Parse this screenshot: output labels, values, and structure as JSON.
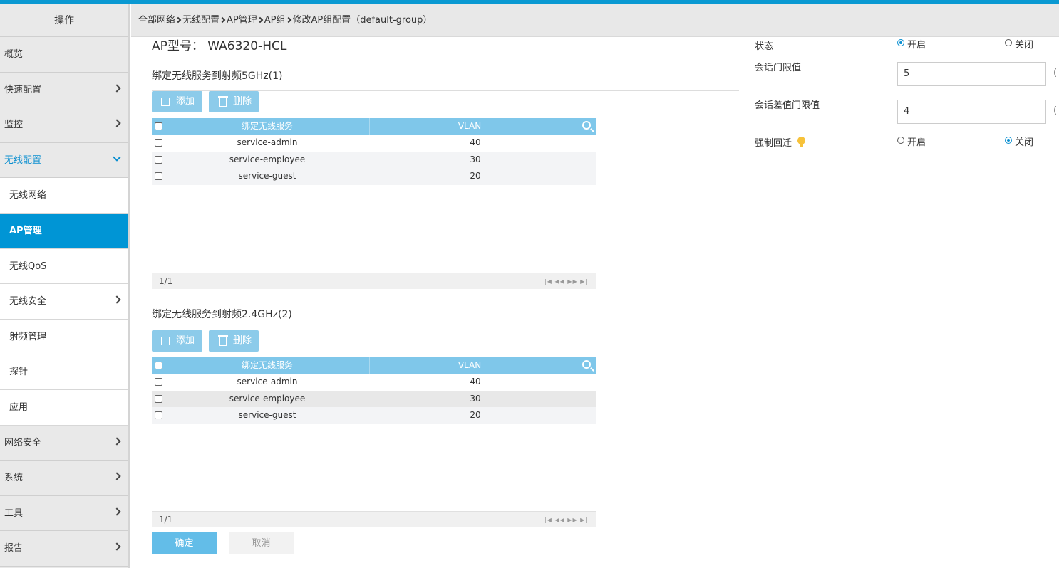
{
  "sidebar": {
    "header": "操作",
    "items": [
      {
        "label": "概览"
      },
      {
        "label": "快速配置"
      },
      {
        "label": "监控"
      },
      {
        "label": "无线配置"
      },
      {
        "label": "无线网络"
      },
      {
        "label": "AP管理"
      },
      {
        "label": "无线QoS"
      },
      {
        "label": "无线安全"
      },
      {
        "label": "射频管理"
      },
      {
        "label": "探针"
      },
      {
        "label": "应用"
      },
      {
        "label": "网络安全"
      },
      {
        "label": "系统"
      },
      {
        "label": "工具"
      },
      {
        "label": "报告"
      }
    ]
  },
  "breadcrumb": {
    "items": [
      "全部网络",
      "无线配置",
      "AP管理",
      "AP组",
      "修改AP组配置（default-group）"
    ]
  },
  "main": {
    "ap_model": "AP型号： WA6320-HCL",
    "section1": {
      "title": "绑定无线服务到射频5GHz(1)",
      "add_label": "添加",
      "delete_label": "删除",
      "col_service": "绑定无线服务",
      "col_vlan": "VLAN",
      "rows": [
        {
          "service": "service-admin",
          "vlan": "40"
        },
        {
          "service": "service-employee",
          "vlan": "30"
        },
        {
          "service": "service-guest",
          "vlan": "20"
        }
      ],
      "pager": "1/1"
    },
    "section2": {
      "title": "绑定无线服务到射频2.4GHz(2)",
      "add_label": "添加",
      "delete_label": "删除",
      "col_service": "绑定无线服务",
      "col_vlan": "VLAN",
      "rows": [
        {
          "service": "service-admin",
          "vlan": "40"
        },
        {
          "service": "service-employee",
          "vlan": "30"
        },
        {
          "service": "service-guest",
          "vlan": "20"
        }
      ],
      "pager": "1/1"
    },
    "ok_label": "确定",
    "cancel_label": "取消"
  },
  "right": {
    "status_label": "状态",
    "status_on": "开启",
    "status_off": "关闭",
    "session_threshold_label": "会话门限值",
    "session_threshold_value": "5",
    "session_diff_label": "会话差值门限值",
    "session_diff_value": "4",
    "force_roam_label": "强制回迁",
    "force_on": "开启",
    "force_off": "关闭",
    "paren": "("
  },
  "colors": {
    "accent": "#0095d5",
    "header": "#7fc7ea",
    "button": "#8ccbea"
  }
}
